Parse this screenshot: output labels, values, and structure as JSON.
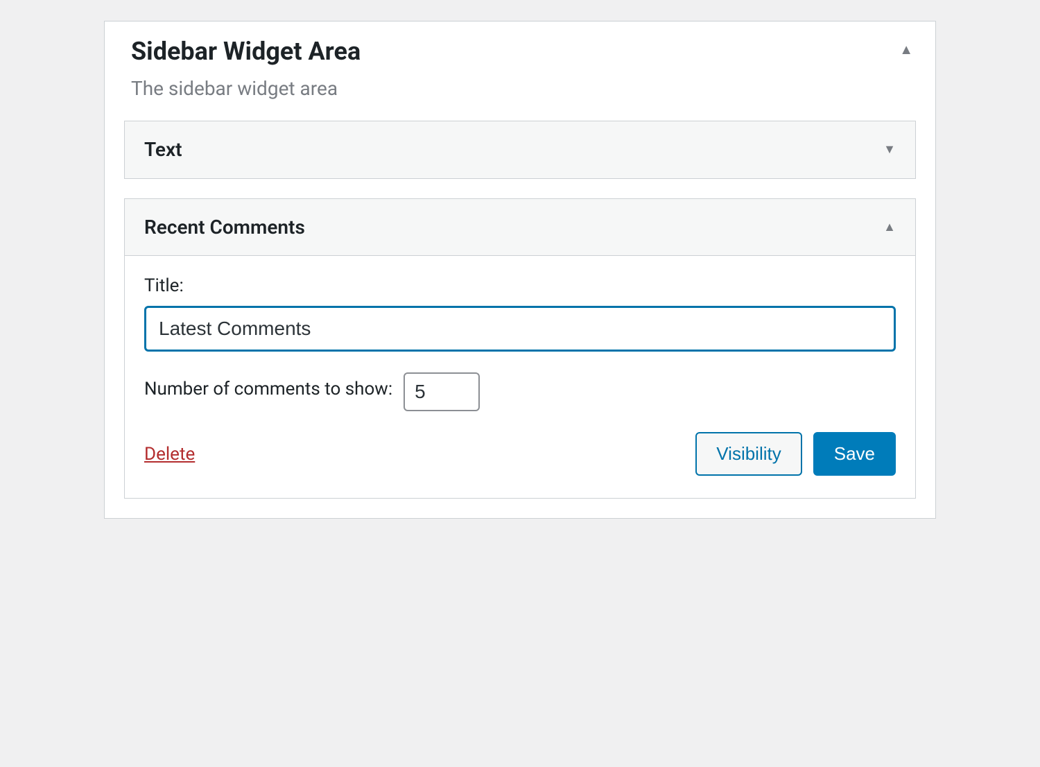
{
  "widgetArea": {
    "title": "Sidebar Widget Area",
    "description": "The sidebar widget area"
  },
  "widgets": {
    "text": {
      "title": "Text"
    },
    "recentComments": {
      "title": "Recent Comments",
      "form": {
        "titleLabel": "Title:",
        "titleValue": "Latest Comments",
        "numberLabel": "Number of comments to show:",
        "numberValue": "5",
        "deleteLabel": "Delete",
        "visibilityLabel": "Visibility",
        "saveLabel": "Save"
      }
    }
  }
}
